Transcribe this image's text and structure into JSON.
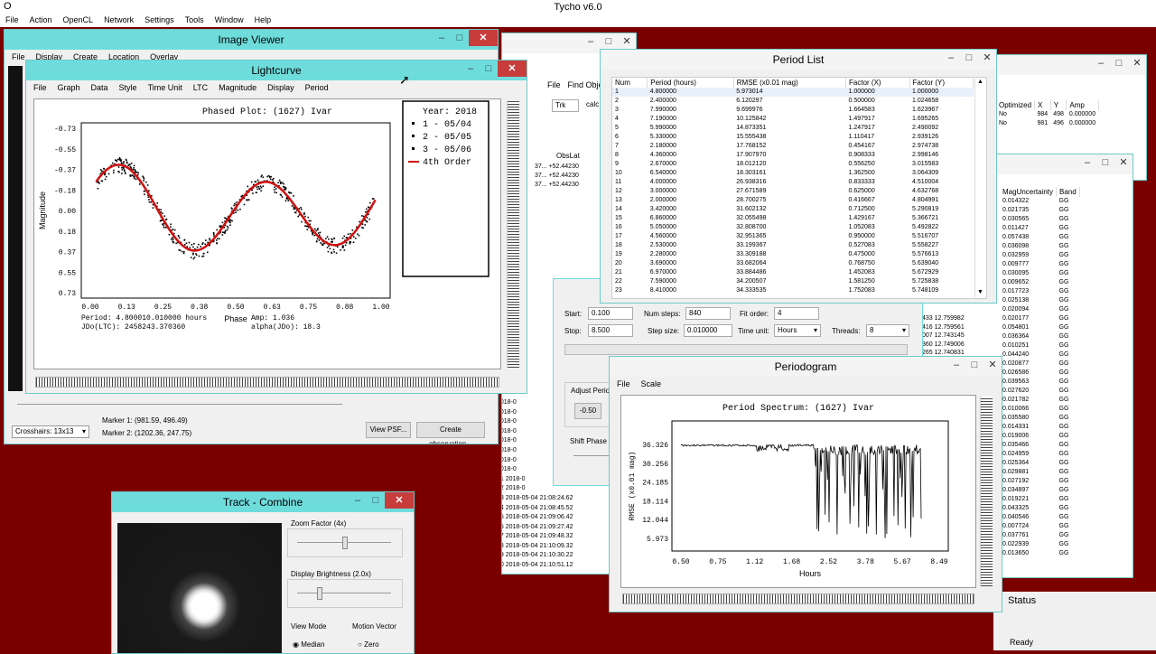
{
  "app": {
    "title": "Tycho v6.0",
    "menu": [
      "File",
      "Action",
      "OpenCL",
      "Network",
      "Settings",
      "Tools",
      "Window",
      "Help"
    ],
    "status_label": "Status",
    "ready": "Ready"
  },
  "image_viewer": {
    "title": "Image Viewer",
    "menu": [
      "File",
      "Display",
      "Create",
      "Location",
      "Overlay"
    ],
    "marker1": "Marker 1:  (981.59, 496.49)",
    "marker2": "Marker 2:  (1202.36, 247.75)",
    "crosshair": "Crosshairs: 13x13",
    "view_psf": "View PSF...",
    "create_obs": "Create observation..."
  },
  "lightcurve": {
    "title": "Lightcurve",
    "menu": [
      "File",
      "Graph",
      "Data",
      "Style",
      "Time Unit",
      "LTC",
      "Magnitude",
      "Display",
      "Period"
    ],
    "plot_title": "Phased Plot: (1627) Ivar",
    "ylabel": "Magnitude",
    "xlabel": "Phase",
    "yticks": [
      "-0.73",
      "-0.55",
      "-0.37",
      "-0.18",
      "0.00",
      "0.18",
      "0.37",
      "0.55",
      "0.73"
    ],
    "xticks": [
      "0.00",
      "0.13",
      "0.25",
      "0.38",
      "0.50",
      "0.63",
      "0.75",
      "0.88",
      "1.00"
    ],
    "legend_title": "Year: 2018",
    "legend": [
      "1 - 05/04",
      "2 - 05/05",
      "3 - 05/06",
      "4th Order"
    ],
    "period": "Period: 4.800010.010000 hours",
    "jdo": "JDo(LTC): 2458243.370360",
    "amp": "Amp: 1.036",
    "alpha": "alpha(JDo): 18.3"
  },
  "period_list": {
    "title": "Period List",
    "headers": [
      "Num",
      "Period (hours)",
      "RMSE (x0.01 mag)",
      "Factor (X)",
      "Factor (Y)"
    ],
    "rows": [
      [
        "1",
        "4.800000",
        "5.973014",
        "1.000000",
        "1.000000"
      ],
      [
        "2",
        "2.400000",
        "6.120297",
        "0.500000",
        "1.024658"
      ],
      [
        "3",
        "7.990000",
        "9.699976",
        "1.664583",
        "1.623967"
      ],
      [
        "4",
        "7.190000",
        "10.125842",
        "1.497917",
        "1.695265"
      ],
      [
        "5",
        "5.990000",
        "14.873351",
        "1.247917",
        "2.490092"
      ],
      [
        "6",
        "5.330000",
        "15.555438",
        "1.110417",
        "2.939126"
      ],
      [
        "7",
        "2.180000",
        "17.768152",
        "0.454167",
        "2.974738"
      ],
      [
        "8",
        "4.360000",
        "17.907970",
        "0.908333",
        "2.998146"
      ],
      [
        "9",
        "2.670000",
        "18.012120",
        "0.556250",
        "3.015583"
      ],
      [
        "10",
        "6.540000",
        "18.303161",
        "1.362500",
        "3.064309"
      ],
      [
        "11",
        "4.000000",
        "26.938316",
        "0.833333",
        "4.510004"
      ],
      [
        "12",
        "3.000000",
        "27.671589",
        "0.625000",
        "4.632768"
      ],
      [
        "13",
        "2.000000",
        "28.700275",
        "0.416667",
        "4.804991"
      ],
      [
        "14",
        "3.420000",
        "31.602132",
        "0.712500",
        "5.290819"
      ],
      [
        "15",
        "6.860000",
        "32.055498",
        "1.429167",
        "5.366721"
      ],
      [
        "16",
        "5.050000",
        "32.808700",
        "1.052083",
        "5.492822"
      ],
      [
        "17",
        "4.560000",
        "32.951365",
        "0.950000",
        "5.516707"
      ],
      [
        "18",
        "2.530000",
        "33.199367",
        "0.527083",
        "5.558227"
      ],
      [
        "19",
        "2.280000",
        "33.309188",
        "0.475000",
        "5.576613"
      ],
      [
        "20",
        "3.690000",
        "33.682064",
        "0.768750",
        "5.639040"
      ],
      [
        "21",
        "6.970000",
        "33.884486",
        "1.452083",
        "5.672929"
      ],
      [
        "22",
        "7.590000",
        "34.200507",
        "1.581250",
        "5.725838"
      ],
      [
        "23",
        "8.410000",
        "34.333535",
        "1.752083",
        "5.748109"
      ]
    ]
  },
  "periodogram": {
    "title": "Periodogram",
    "menu": [
      "File",
      "Scale"
    ],
    "plot_title": "Period Spectrum: (1627) Ivar",
    "ylabel": "RMSE (x0.01 mag)",
    "xlabel": "Hours",
    "yticks": [
      "36.326",
      "30.256",
      "24.185",
      "18.114",
      "12.044",
      "5.973"
    ],
    "xticks": [
      "0.50",
      "0.75",
      "1.12",
      "1.68",
      "2.52",
      "3.78",
      "5.67",
      "8.49"
    ]
  },
  "search_panel": {
    "start_label": "Start:",
    "start_value": "0.100",
    "stop_label": "Stop:",
    "stop_value": "8.500",
    "numsteps_label": "Num steps:",
    "numsteps_value": "840",
    "step_label": "Step size:",
    "step_value": "0.010000",
    "fit_label": "Fit order:",
    "fit_value": "4",
    "time_unit_label": "Time unit:",
    "time_unit_value": "Hours",
    "threads_label": "Threads:",
    "threads_value": "8",
    "adjust": "Adjust Period",
    "adjust_value": "-0.50",
    "shift": "Shift Phase (deg)"
  },
  "track": {
    "title": "Track - Combine",
    "zoom_label": "Zoom Factor (4x)",
    "brightness_label": "Display Brightness (2.0x)",
    "view_mode": "View Mode",
    "motion_vector": "Motion Vector",
    "median": "Median",
    "zero": "Zero"
  },
  "obs_table": {
    "menu": [
      "File",
      "Find Obje"
    ],
    "tab": "Trk",
    "tab2": "calc",
    "col": "ObsLat",
    "lat_rows": [
      "+52.44230",
      "+52.44230",
      "+52.44230"
    ],
    "dec_rows": [
      "37...",
      "37...",
      "37..."
    ],
    "dates": [
      [
        "",
        "2018-0"
      ],
      [
        "",
        "2018-0"
      ],
      [
        "",
        "2018-0"
      ],
      [
        "",
        "2018-0"
      ],
      [
        "",
        "2018-0"
      ],
      [
        "",
        "2018-0"
      ],
      [
        "",
        "2018-0"
      ],
      [
        "",
        "2018-0"
      ],
      [
        "",
        "2018-0"
      ],
      [
        "",
        "2018-0"
      ],
      [
        "",
        "2018-0"
      ],
      [
        "",
        "2018-0"
      ],
      [
        "",
        "2018-0"
      ],
      [
        "31",
        "2018-0"
      ],
      [
        "32",
        "2018-0"
      ],
      [
        "33",
        "2018-05-04 21:08:24.62"
      ],
      [
        "34",
        "2018-05-04 21:08:45.52"
      ],
      [
        "35",
        "2018-05-04 21:09:06.42"
      ],
      [
        "36",
        "2018-05-04 21:09:27.42"
      ],
      [
        "37",
        "2018-05-04 21:09:48.32"
      ],
      [
        "38",
        "2018-05-04 21:10:09.32"
      ],
      [
        "39",
        "2018-05-04 21:10:30.22"
      ],
      [
        "40",
        "2018-05-04 21:10:51.12"
      ]
    ]
  },
  "right_table": {
    "headers": [
      "Optimized",
      "X",
      "Y",
      "Amp"
    ],
    "rows": [
      [
        "No",
        "984",
        "498",
        "0.000000"
      ],
      [
        "No",
        "981",
        "496",
        "0.000000"
      ]
    ]
  },
  "mag_table": {
    "headers": [
      "MagUncertainty",
      "Band"
    ],
    "rows": [
      [
        "0.014322",
        "GG"
      ],
      [
        "0.021735",
        "GG"
      ],
      [
        "0.030565",
        "GG"
      ],
      [
        "0.011427",
        "GG"
      ],
      [
        "0.057438",
        "GG"
      ],
      [
        "0.036098",
        "GG"
      ],
      [
        "0.032959",
        "GG"
      ],
      [
        "0.009777",
        "GG"
      ],
      [
        "0.030095",
        "GG"
      ],
      [
        "0.009652",
        "GG"
      ],
      [
        "0.017723",
        "GG"
      ],
      [
        "0.025138",
        "GG"
      ],
      [
        "0.020094",
        "GG"
      ],
      [
        "0.020177",
        "GG"
      ],
      [
        "0.054801",
        "GG"
      ],
      [
        "0.036364",
        "GG"
      ],
      [
        "0.010251",
        "GG"
      ],
      [
        "0.044240",
        "GG"
      ],
      [
        "0.020877",
        "GG"
      ],
      [
        "0.026586",
        "GG"
      ],
      [
        "0.039563",
        "GG"
      ],
      [
        "0.027620",
        "GG"
      ],
      [
        "0.021782",
        "GG"
      ],
      [
        "0.010066",
        "GG"
      ],
      [
        "0.035580",
        "GG"
      ],
      [
        "0.014331",
        "GG"
      ],
      [
        "0.019006",
        "GG"
      ],
      [
        "0.035466",
        "GG"
      ],
      [
        "0.024959",
        "GG"
      ],
      [
        "0.025364",
        "GG"
      ],
      [
        "0.029881",
        "GG"
      ],
      [
        "0.027192",
        "GG"
      ],
      [
        "0.034897",
        "GG"
      ],
      [
        "0.019221",
        "GG"
      ],
      [
        "0.043325",
        "GG"
      ],
      [
        "0.040546",
        "GG"
      ],
      [
        "0.007724",
        "GG"
      ],
      [
        "0.037761",
        "GG"
      ],
      [
        "0.022939",
        "GG"
      ],
      [
        "0.013650",
        "GG"
      ]
    ],
    "mid": [
      [
        "433",
        "12.759982"
      ],
      [
        "416",
        "12.759561"
      ],
      [
        "007",
        "12.743145"
      ],
      [
        "360",
        "12.749006"
      ],
      [
        "265",
        "12.740831"
      ],
      [
        "009",
        "..."
      ]
    ]
  },
  "colors": {
    "title_active": "#6fdcdc",
    "desktop": "#7a0000",
    "curve_fit": "#d01010",
    "close": "#c83c3c"
  }
}
